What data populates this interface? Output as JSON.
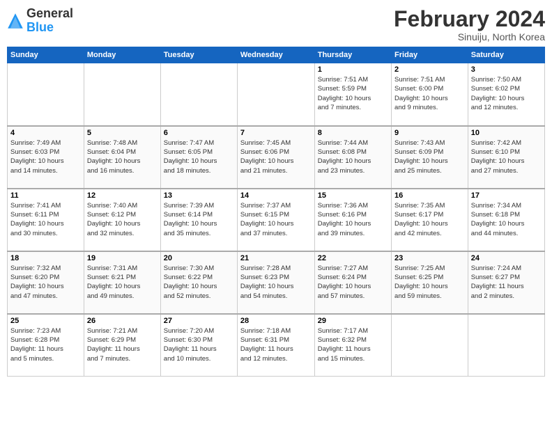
{
  "header": {
    "logo_general": "General",
    "logo_blue": "Blue",
    "month_title": "February 2024",
    "location": "Sinuiju, North Korea"
  },
  "weekdays": [
    "Sunday",
    "Monday",
    "Tuesday",
    "Wednesday",
    "Thursday",
    "Friday",
    "Saturday"
  ],
  "weeks": [
    [
      {
        "day": "",
        "info": ""
      },
      {
        "day": "",
        "info": ""
      },
      {
        "day": "",
        "info": ""
      },
      {
        "day": "",
        "info": ""
      },
      {
        "day": "1",
        "info": "Sunrise: 7:51 AM\nSunset: 5:59 PM\nDaylight: 10 hours\nand 7 minutes."
      },
      {
        "day": "2",
        "info": "Sunrise: 7:51 AM\nSunset: 6:00 PM\nDaylight: 10 hours\nand 9 minutes."
      },
      {
        "day": "3",
        "info": "Sunrise: 7:50 AM\nSunset: 6:02 PM\nDaylight: 10 hours\nand 12 minutes."
      }
    ],
    [
      {
        "day": "4",
        "info": "Sunrise: 7:49 AM\nSunset: 6:03 PM\nDaylight: 10 hours\nand 14 minutes."
      },
      {
        "day": "5",
        "info": "Sunrise: 7:48 AM\nSunset: 6:04 PM\nDaylight: 10 hours\nand 16 minutes."
      },
      {
        "day": "6",
        "info": "Sunrise: 7:47 AM\nSunset: 6:05 PM\nDaylight: 10 hours\nand 18 minutes."
      },
      {
        "day": "7",
        "info": "Sunrise: 7:45 AM\nSunset: 6:06 PM\nDaylight: 10 hours\nand 21 minutes."
      },
      {
        "day": "8",
        "info": "Sunrise: 7:44 AM\nSunset: 6:08 PM\nDaylight: 10 hours\nand 23 minutes."
      },
      {
        "day": "9",
        "info": "Sunrise: 7:43 AM\nSunset: 6:09 PM\nDaylight: 10 hours\nand 25 minutes."
      },
      {
        "day": "10",
        "info": "Sunrise: 7:42 AM\nSunset: 6:10 PM\nDaylight: 10 hours\nand 27 minutes."
      }
    ],
    [
      {
        "day": "11",
        "info": "Sunrise: 7:41 AM\nSunset: 6:11 PM\nDaylight: 10 hours\nand 30 minutes."
      },
      {
        "day": "12",
        "info": "Sunrise: 7:40 AM\nSunset: 6:12 PM\nDaylight: 10 hours\nand 32 minutes."
      },
      {
        "day": "13",
        "info": "Sunrise: 7:39 AM\nSunset: 6:14 PM\nDaylight: 10 hours\nand 35 minutes."
      },
      {
        "day": "14",
        "info": "Sunrise: 7:37 AM\nSunset: 6:15 PM\nDaylight: 10 hours\nand 37 minutes."
      },
      {
        "day": "15",
        "info": "Sunrise: 7:36 AM\nSunset: 6:16 PM\nDaylight: 10 hours\nand 39 minutes."
      },
      {
        "day": "16",
        "info": "Sunrise: 7:35 AM\nSunset: 6:17 PM\nDaylight: 10 hours\nand 42 minutes."
      },
      {
        "day": "17",
        "info": "Sunrise: 7:34 AM\nSunset: 6:18 PM\nDaylight: 10 hours\nand 44 minutes."
      }
    ],
    [
      {
        "day": "18",
        "info": "Sunrise: 7:32 AM\nSunset: 6:20 PM\nDaylight: 10 hours\nand 47 minutes."
      },
      {
        "day": "19",
        "info": "Sunrise: 7:31 AM\nSunset: 6:21 PM\nDaylight: 10 hours\nand 49 minutes."
      },
      {
        "day": "20",
        "info": "Sunrise: 7:30 AM\nSunset: 6:22 PM\nDaylight: 10 hours\nand 52 minutes."
      },
      {
        "day": "21",
        "info": "Sunrise: 7:28 AM\nSunset: 6:23 PM\nDaylight: 10 hours\nand 54 minutes."
      },
      {
        "day": "22",
        "info": "Sunrise: 7:27 AM\nSunset: 6:24 PM\nDaylight: 10 hours\nand 57 minutes."
      },
      {
        "day": "23",
        "info": "Sunrise: 7:25 AM\nSunset: 6:25 PM\nDaylight: 10 hours\nand 59 minutes."
      },
      {
        "day": "24",
        "info": "Sunrise: 7:24 AM\nSunset: 6:27 PM\nDaylight: 11 hours\nand 2 minutes."
      }
    ],
    [
      {
        "day": "25",
        "info": "Sunrise: 7:23 AM\nSunset: 6:28 PM\nDaylight: 11 hours\nand 5 minutes."
      },
      {
        "day": "26",
        "info": "Sunrise: 7:21 AM\nSunset: 6:29 PM\nDaylight: 11 hours\nand 7 minutes."
      },
      {
        "day": "27",
        "info": "Sunrise: 7:20 AM\nSunset: 6:30 PM\nDaylight: 11 hours\nand 10 minutes."
      },
      {
        "day": "28",
        "info": "Sunrise: 7:18 AM\nSunset: 6:31 PM\nDaylight: 11 hours\nand 12 minutes."
      },
      {
        "day": "29",
        "info": "Sunrise: 7:17 AM\nSunset: 6:32 PM\nDaylight: 11 hours\nand 15 minutes."
      },
      {
        "day": "",
        "info": ""
      },
      {
        "day": "",
        "info": ""
      }
    ]
  ]
}
